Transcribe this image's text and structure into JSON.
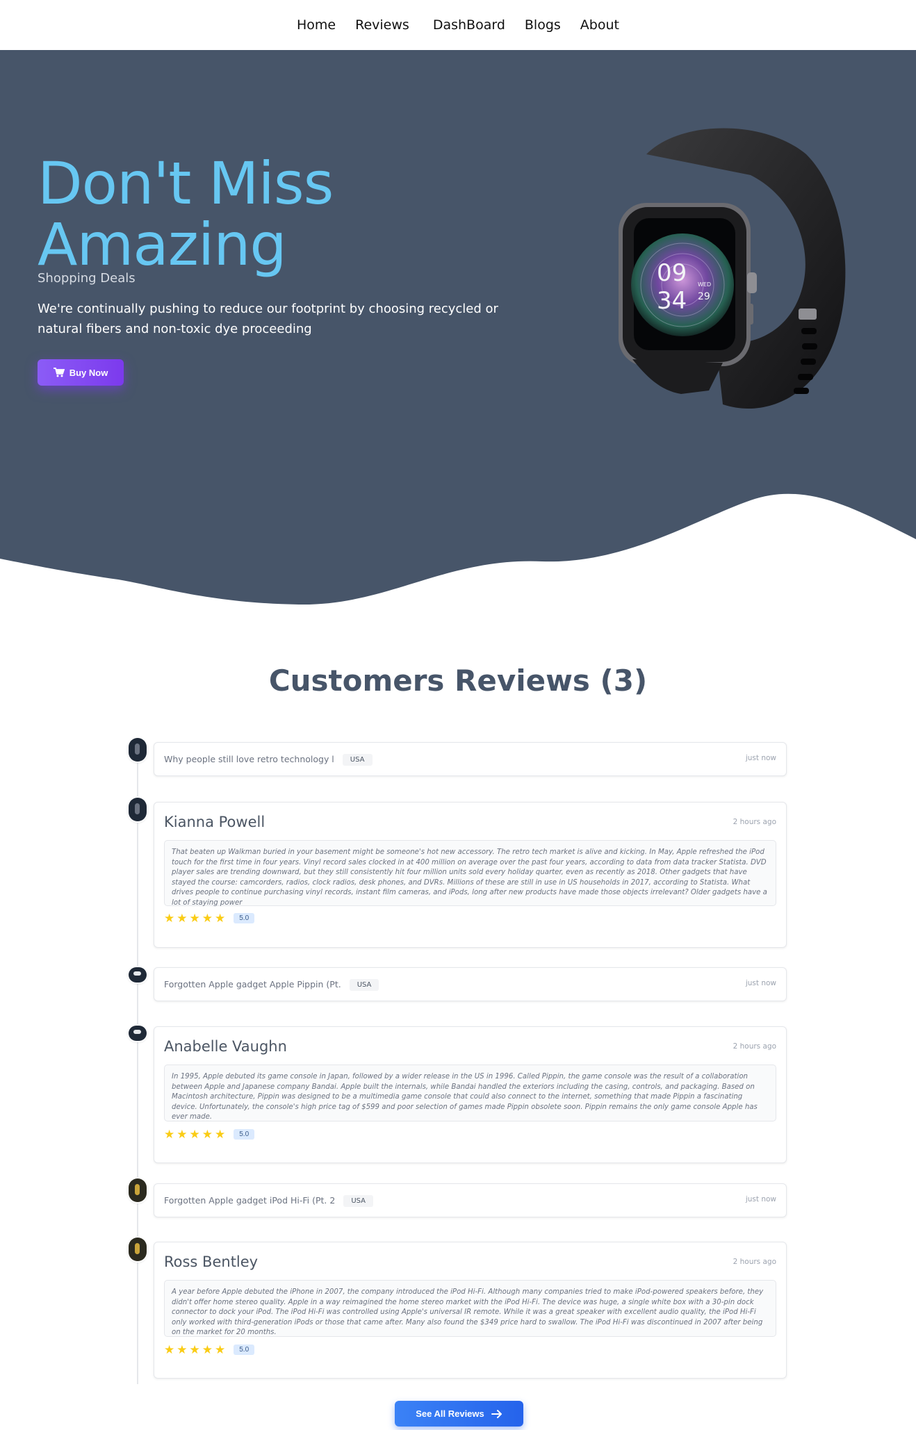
{
  "nav": {
    "items": [
      {
        "label": "Home"
      },
      {
        "label": "Reviews"
      },
      {
        "label": "DashBoard"
      },
      {
        "label": "Blogs"
      },
      {
        "label": "About"
      }
    ]
  },
  "hero": {
    "title_line1": "Don't Miss",
    "title_line2": "Amazing",
    "subtitle": "Shopping Deals",
    "description": "We're continually pushing to reduce our footprint by choosing recycled or natural fibers and non-toxic dye proceeding",
    "buy_button": "Buy Now",
    "watch_hour": "09",
    "watch_minute": "34",
    "watch_day": "WED",
    "watch_date": "29"
  },
  "reviews": {
    "title": "Customers Reviews (3)",
    "entries": [
      {
        "headline": "Why people still love retro technology l",
        "country": "USA",
        "posted": "just now",
        "name": "Kianna Powell",
        "time": "2 hours ago",
        "text": "That beaten up Walkman buried in your basement might be someone's hot new accessory. The retro tech market is alive and kicking. In May, Apple refreshed the iPod touch for the first time in four years. Vinyl record sales clocked in at 400 million on average over the past four years, according to data from data tracker Statista. DVD player sales are trending downward, but they still consistently hit four million units sold every holiday quarter, even as recently as 2018. Other gadgets that have stayed the course: camcorders, radios, clock radios, desk phones, and DVRs. Millions of these are still in use in US households in 2017, according to Statista. What drives people to continue purchasing vinyl records, instant film cameras, and iPods, long after new products have made those objects irrelevant? Older gadgets have a lot of staying power",
        "rating": 5,
        "rating_label": "5.0"
      },
      {
        "headline": "Forgotten Apple gadget Apple Pippin (Pt.",
        "country": "USA",
        "posted": "just now",
        "name": "Anabelle Vaughn",
        "time": "2 hours ago",
        "text": "In 1995, Apple debuted its game console in Japan, followed by a wider release in the US in 1996. Called Pippin, the game console was the result of a collaboration between Apple and Japanese company Bandai. Apple built the internals, while Bandai handled the exteriors including the casing, controls, and packaging. Based on Macintosh architecture, Pippin was designed to be a multimedia game console that could also connect to the internet, something that made Pippin a fascinating device. Unfortunately, the console's high price tag of $599 and poor selection of games made Pippin obsolete soon. Pippin remains the only game console Apple has ever made.",
        "rating": 5,
        "rating_label": "5.0"
      },
      {
        "headline": "Forgotten Apple gadget iPod Hi-Fi (Pt. 2",
        "country": "USA",
        "posted": "just now",
        "name": "Ross Bentley",
        "time": "2 hours ago",
        "text": "A year before Apple debuted the iPhone in 2007, the company introduced the iPod Hi-Fi. Although many companies tried to make iPod-powered speakers before, they didn't offer home stereo quality. Apple in a way reimagined the home stereo market with the iPod Hi-Fi. The device was huge, a single white box with a 30-pin dock connector to dock your iPod. The iPod Hi-Fi was controlled using Apple's universal IR remote. While it was a great speaker with excellent audio quality, the iPod Hi-Fi only worked with third-generation iPods or those that came after. Many also found the $349 price hard to swallow. The iPod Hi-Fi was discontinued in 2007 after being on the market for 20 months.",
        "rating": 5,
        "rating_label": "5.0"
      }
    ],
    "see_all": "See All Reviews"
  },
  "colors": {
    "hero_bg": "#475569",
    "hero_title": "#67c7f2",
    "buy_button": "#8b5cf6",
    "see_all_button": "#2563eb",
    "star": "#facc15"
  }
}
